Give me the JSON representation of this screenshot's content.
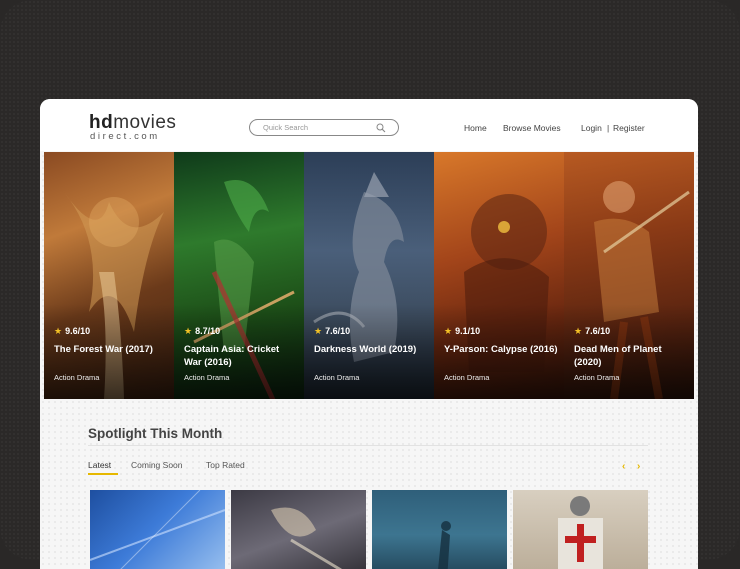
{
  "logo": {
    "main_bold": "hd",
    "main_rest": "movies",
    "sub": "direct.com"
  },
  "search": {
    "placeholder": "Quick Search"
  },
  "nav": {
    "home": "Home",
    "browse": "Browse Movies",
    "login": "Login",
    "separator": "|",
    "register": "Register"
  },
  "hero": {
    "movies": [
      {
        "rating": "9.6/10",
        "title": "The Forest War (2017)",
        "genre": "Action Drama"
      },
      {
        "rating": "8.7/10",
        "title": "Captain Asia: Cricket War (2016)",
        "genre": "Action Drama"
      },
      {
        "rating": "7.6/10",
        "title": "Darkness World (2019)",
        "genre": "Action Drama"
      },
      {
        "rating": "9.1/10",
        "title": "Y-Parson: Calypse (2016)",
        "genre": "Action Drama"
      },
      {
        "rating": "7.6/10",
        "title": "Dead Men of Planet (2020)",
        "genre": "Action Drama"
      }
    ]
  },
  "spotlight": {
    "title": "Spotlight This Month",
    "tabs": [
      "Latest",
      "Coming Soon",
      "Top Rated"
    ],
    "active_tab": "Latest",
    "prev_icon": "‹",
    "next_icon": "›"
  },
  "colors": {
    "accent": "#e6b800",
    "star": "#f3c226"
  }
}
